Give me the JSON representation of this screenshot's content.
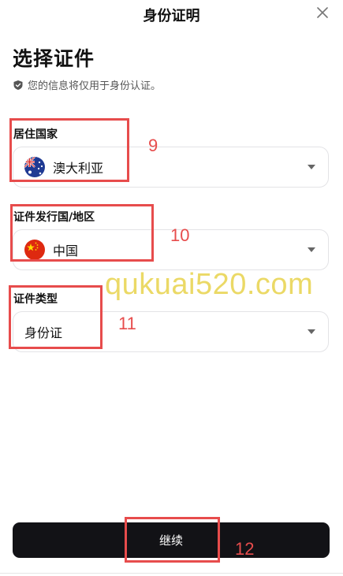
{
  "header": {
    "title": "身份证明",
    "close_icon": "close-icon"
  },
  "main_title": "选择证件",
  "privacy_note": "您的信息将仅用于身份认证。",
  "fields": [
    {
      "label": "居住国家",
      "value": "澳大利亚",
      "flag": "australia-flag-icon"
    },
    {
      "label": "证件发行国/地区",
      "value": "中国",
      "flag": "china-flag-icon"
    },
    {
      "label": "证件类型",
      "value": "身份证"
    }
  ],
  "annotations": [
    "9",
    "10",
    "11",
    "12"
  ],
  "watermark": "qukuai520.com",
  "continue_label": "继续",
  "colors": {
    "annotation": "#e74c4c",
    "button_bg": "#121216",
    "watermark": "#e8d34c"
  }
}
